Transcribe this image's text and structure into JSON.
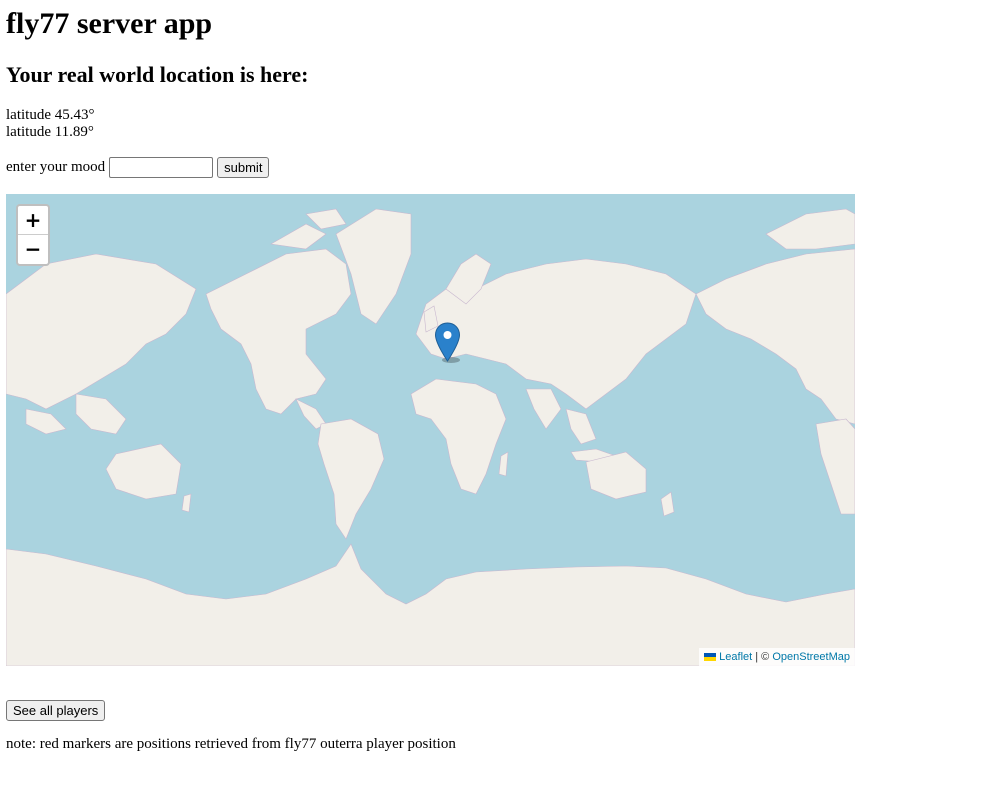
{
  "header": {
    "title": "fly77 server app",
    "subtitle": "Your real world location is here:"
  },
  "location": {
    "line1": "latitude 45.43°",
    "line2": "latitude 11.89°"
  },
  "mood": {
    "label": "enter your mood",
    "value": "",
    "submit_label": "submit"
  },
  "map": {
    "zoom_in_label": "+",
    "zoom_out_label": "−",
    "attribution_leaflet": "Leaflet",
    "attribution_separator": " | © ",
    "attribution_osm": "OpenStreetMap",
    "water_color": "#aad3df",
    "land_color": "#f2efe9",
    "marker_color": "#2a81cb",
    "marker_icon": "map-pin-icon"
  },
  "players_button_label": "See all players",
  "note": "note: red markers are positions retrieved from fly77 outerra player position"
}
